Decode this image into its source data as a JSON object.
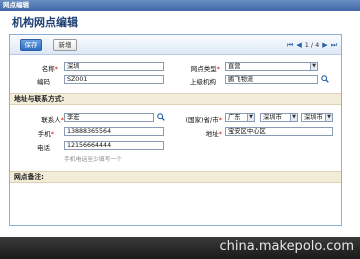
{
  "window": {
    "title": "网点编辑"
  },
  "page": {
    "title": "机构网点编辑"
  },
  "toolbar": {
    "save_label": "保存",
    "new_label": "新增",
    "page_indicator": "1 / 4"
  },
  "basic": {
    "name_label": "名称",
    "name_value": "深圳",
    "code_label": "编码",
    "code_value": "SZ001",
    "type_label": "网点类型",
    "type_value": "直营",
    "parent_label": "上级机构",
    "parent_value": "鹏飞物流"
  },
  "address_section": {
    "title": "地址与联系方式:",
    "contact_label": "联系人",
    "contact_value": "李宏",
    "mobile_label": "手机",
    "mobile_value": "13888365564",
    "phone_label": "电话",
    "phone_value": "12156664444",
    "hint": "手机电话至少填写一个",
    "region_label": "(国家)省/市",
    "country_value": "广东",
    "province_value": "深圳市",
    "city_value": "深圳市",
    "address_label": "地址",
    "address_value": "宝安区中心区"
  },
  "notes_section": {
    "title": "网点备注:"
  },
  "watermark": "china.makepolo.com"
}
